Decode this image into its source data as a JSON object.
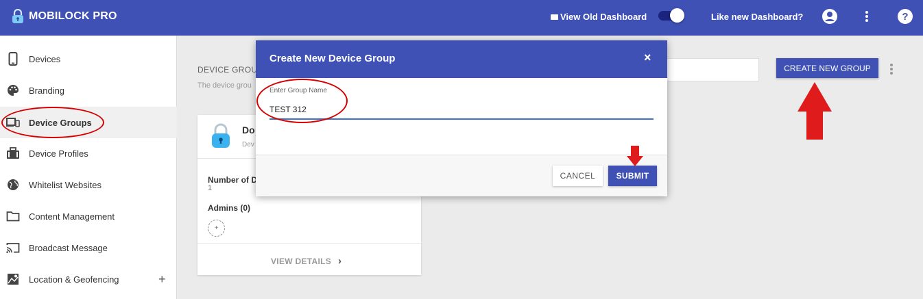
{
  "header": {
    "brand": "MOBILOCK PRO",
    "view_old_dashboard": "View Old Dashboard",
    "like_new_dashboard": "Like new Dashboard?",
    "accent_color": "#3f51b5"
  },
  "sidebar": {
    "items": [
      {
        "label": "Devices",
        "icon": "phone-icon"
      },
      {
        "label": "Branding",
        "icon": "palette-icon"
      },
      {
        "label": "Device Groups",
        "icon": "devices-icon",
        "active": true
      },
      {
        "label": "Device Profiles",
        "icon": "briefcase-icon"
      },
      {
        "label": "Whitelist Websites",
        "icon": "globe-icon"
      },
      {
        "label": "Content Management",
        "icon": "folder-icon"
      },
      {
        "label": "Broadcast Message",
        "icon": "cast-icon"
      },
      {
        "label": "Location & Geofencing",
        "icon": "map-icon",
        "expand": "+"
      }
    ]
  },
  "main": {
    "section_title": "DEVICE GROU",
    "section_subtitle": "The device grou",
    "create_button": "CREATE NEW GROUP",
    "group_card": {
      "name": "Do",
      "desc": "Dev",
      "number_label": "Number of D",
      "number_value": "1",
      "admins_label": "Admins (0)",
      "add_admin": "+",
      "view_details": "VIEW DETAILS",
      "view_chevron": "›"
    }
  },
  "modal": {
    "title": "Create New Device Group",
    "close": "×",
    "field_label": "Enter Group Name",
    "field_value": "TEST 312",
    "cancel": "CANCEL",
    "submit": "SUBMIT"
  },
  "annotation_color": "#d50000"
}
